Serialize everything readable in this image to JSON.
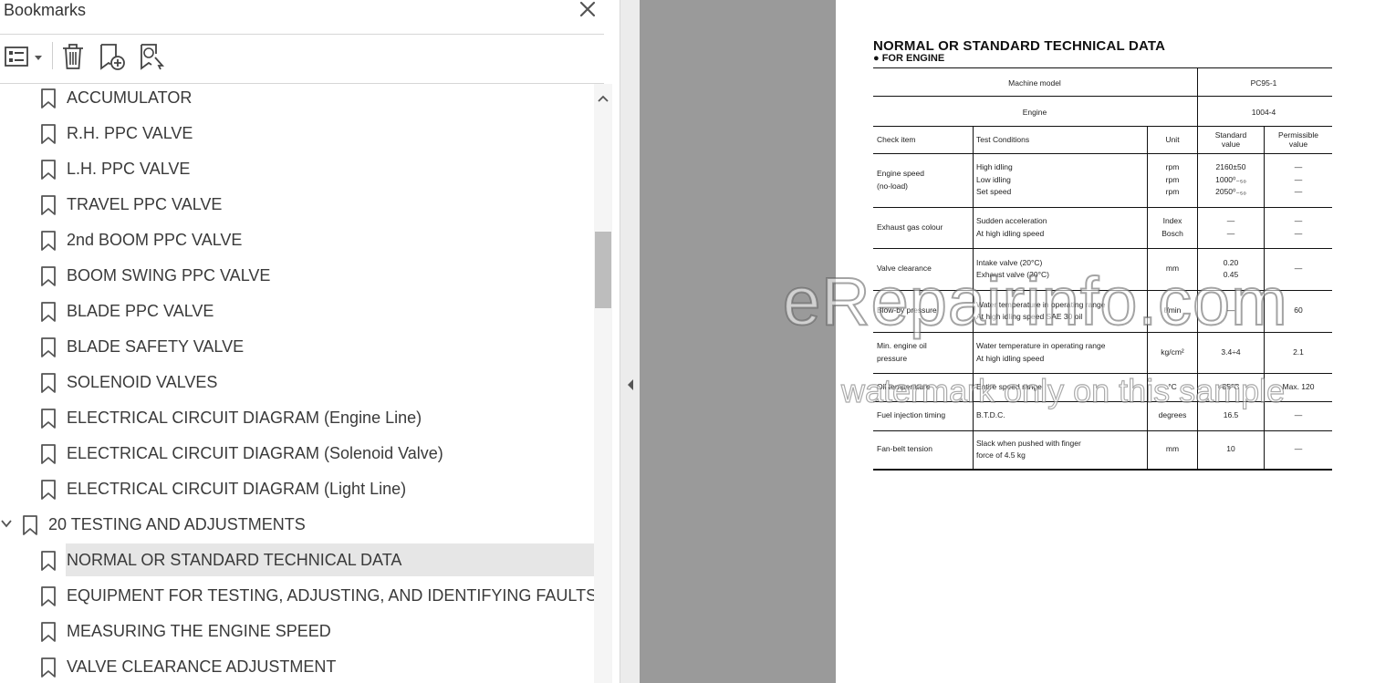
{
  "panel": {
    "title": "Bookmarks",
    "close_icon": "close-icon",
    "toolbar": {
      "options_icon": "list-options-icon",
      "delete_icon": "trash-icon",
      "new_bookmark_icon": "add-bookmark-icon",
      "find_bookmark_icon": "find-bookmark-icon"
    }
  },
  "bookmarks": [
    {
      "label": "ACCUMULATOR",
      "level": 2
    },
    {
      "label": "R.H. PPC VALVE",
      "level": 2
    },
    {
      "label": "L.H. PPC VALVE",
      "level": 2
    },
    {
      "label": "TRAVEL PPC VALVE",
      "level": 2
    },
    {
      "label": "2nd BOOM PPC VALVE",
      "level": 2
    },
    {
      "label": "BOOM SWING PPC VALVE",
      "level": 2
    },
    {
      "label": "BLADE PPC VALVE",
      "level": 2
    },
    {
      "label": "BLADE SAFETY VALVE",
      "level": 2
    },
    {
      "label": "SOLENOID VALVES",
      "level": 2
    },
    {
      "label": "ELECTRICAL CIRCUIT DIAGRAM (Engine Line)",
      "level": 2
    },
    {
      "label": "ELECTRICAL CIRCUIT DIAGRAM (Solenoid Valve)",
      "level": 2
    },
    {
      "label": "ELECTRICAL CIRCUIT DIAGRAM (Light Line)",
      "level": 2
    },
    {
      "label": "20 TESTING AND ADJUSTMENTS",
      "level": 1,
      "expanded": true
    },
    {
      "label": "NORMAL OR STANDARD TECHNICAL DATA",
      "level": 2,
      "selected": true
    },
    {
      "label": "EQUIPMENT FOR TESTING, ADJUSTING, AND IDENTIFYING FAULTS",
      "level": 2
    },
    {
      "label": "MEASURING THE ENGINE SPEED",
      "level": 2
    },
    {
      "label": "VALVE CLEARANCE ADJUSTMENT",
      "level": 2
    }
  ],
  "document": {
    "title": "NORMAL OR STANDARD TECHNICAL DATA",
    "subtitle": "● FOR ENGINE",
    "machine_model_label": "Machine model",
    "machine_model": "PC95-1",
    "engine_label": "Engine",
    "engine": "1004-4",
    "headers": {
      "check_item": "Check item",
      "test_conditions": "Test Conditions",
      "unit": "Unit",
      "standard": [
        "Standard",
        "value"
      ],
      "permissible": [
        "Permissible",
        "value"
      ]
    },
    "rows": [
      {
        "check": [
          "Engine speed",
          "(no-load)"
        ],
        "conditions": [
          "High idling",
          "Low idling",
          "Set speed"
        ],
        "units": [
          "rpm",
          "rpm",
          "rpm"
        ],
        "standard": [
          "2160±50",
          "1000⁰₋₅₀",
          "2050⁰₋₅₀"
        ],
        "permissible": [
          "—",
          "—",
          "—"
        ]
      },
      {
        "check": [
          "Exhaust gas colour"
        ],
        "conditions": [
          "Sudden acceleration",
          "At high idling speed"
        ],
        "units": [
          "Index",
          "Bosch"
        ],
        "standard": [
          "—",
          "—"
        ],
        "permissible": [
          "—",
          "—"
        ]
      },
      {
        "check": [
          "Valve clearance"
        ],
        "conditions": [
          "Intake valve (20°C)",
          "Exhaust valve (20°C)"
        ],
        "units": [
          "mm"
        ],
        "standard": [
          "0.20",
          "0.45"
        ],
        "permissible": [
          "—"
        ]
      },
      {
        "check": [
          "Blow-by pressure"
        ],
        "conditions": [
          "Water temperature in operating range",
          "At high idling speed SAE 30 oil"
        ],
        "units": [
          "ℓ/min"
        ],
        "standard": [
          "—"
        ],
        "permissible": [
          "60"
        ]
      },
      {
        "check": [
          "Min. engine oil",
          "pressure"
        ],
        "conditions": [
          "Water temperature in operating range",
          "At high idling speed"
        ],
        "units": [
          "kg/cm²"
        ],
        "standard": [
          "3.4÷4"
        ],
        "permissible": [
          "2.1"
        ]
      },
      {
        "check": [
          "Oil temperature"
        ],
        "conditions": [
          "Entire speed range"
        ],
        "units": [
          "°C"
        ],
        "standard": [
          "85°C"
        ],
        "permissible": [
          "Max. 120"
        ]
      },
      {
        "check": [
          "Fuel injection timing"
        ],
        "conditions": [
          "B.T.D.C."
        ],
        "units": [
          "degrees"
        ],
        "standard": [
          "16.5"
        ],
        "permissible": [
          "—"
        ]
      },
      {
        "check": [
          "Fan-belt tension"
        ],
        "conditions": [
          "Slack when pushed with finger",
          "force of 4.5 kg"
        ],
        "units": [
          "mm"
        ],
        "standard": [
          "10"
        ],
        "permissible": [
          "—"
        ]
      }
    ],
    "watermark_main": "eRepairinfo.com",
    "watermark_sub": "watermark only on this sample"
  }
}
